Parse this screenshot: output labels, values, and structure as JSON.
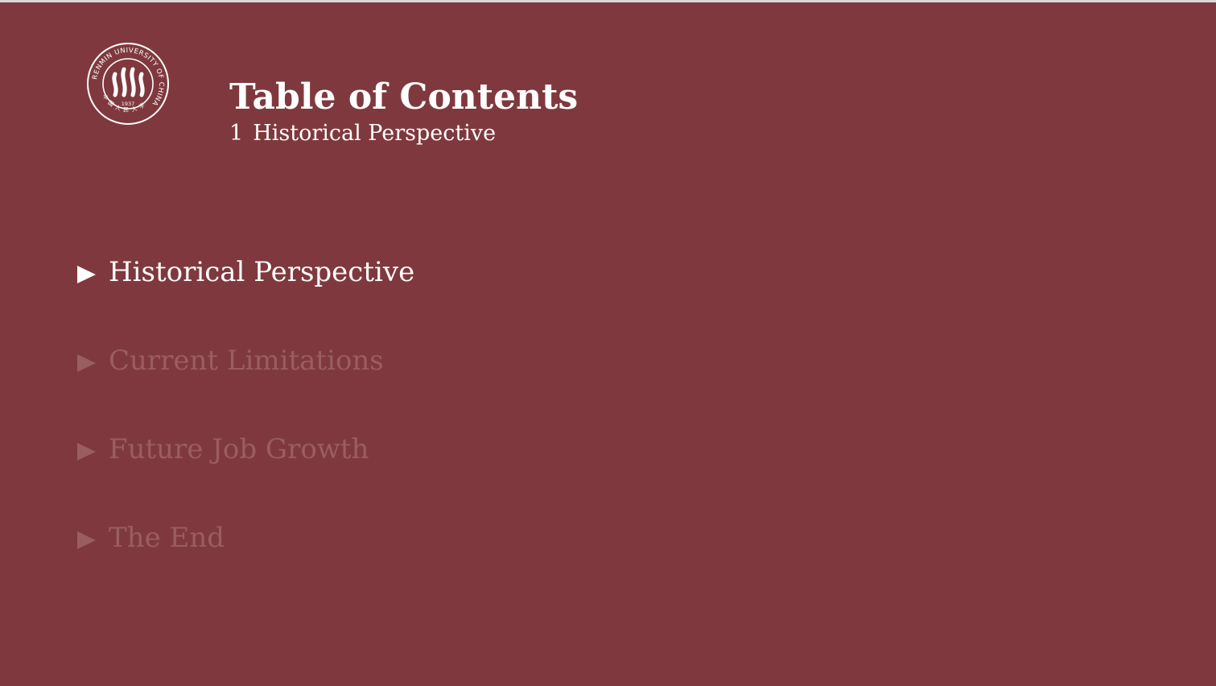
{
  "header": {
    "title": "Table of Contents",
    "subtitle_number": "1",
    "subtitle_text": "Historical Perspective"
  },
  "logo": {
    "ring_text": "RENMIN UNIVERSITY OF CHINA",
    "year": "1937",
    "chinese_name": "中国人民大学"
  },
  "toc": {
    "items": [
      {
        "label": "Historical Perspective",
        "state": "current"
      },
      {
        "label": "Current Limitations",
        "state": "dim"
      },
      {
        "label": "Future Job Growth",
        "state": "dim"
      },
      {
        "label": "The End",
        "state": "dim"
      }
    ]
  },
  "colors": {
    "background": "#7f393e",
    "text": "#ffffff",
    "dimmed": "#9a5d61"
  }
}
